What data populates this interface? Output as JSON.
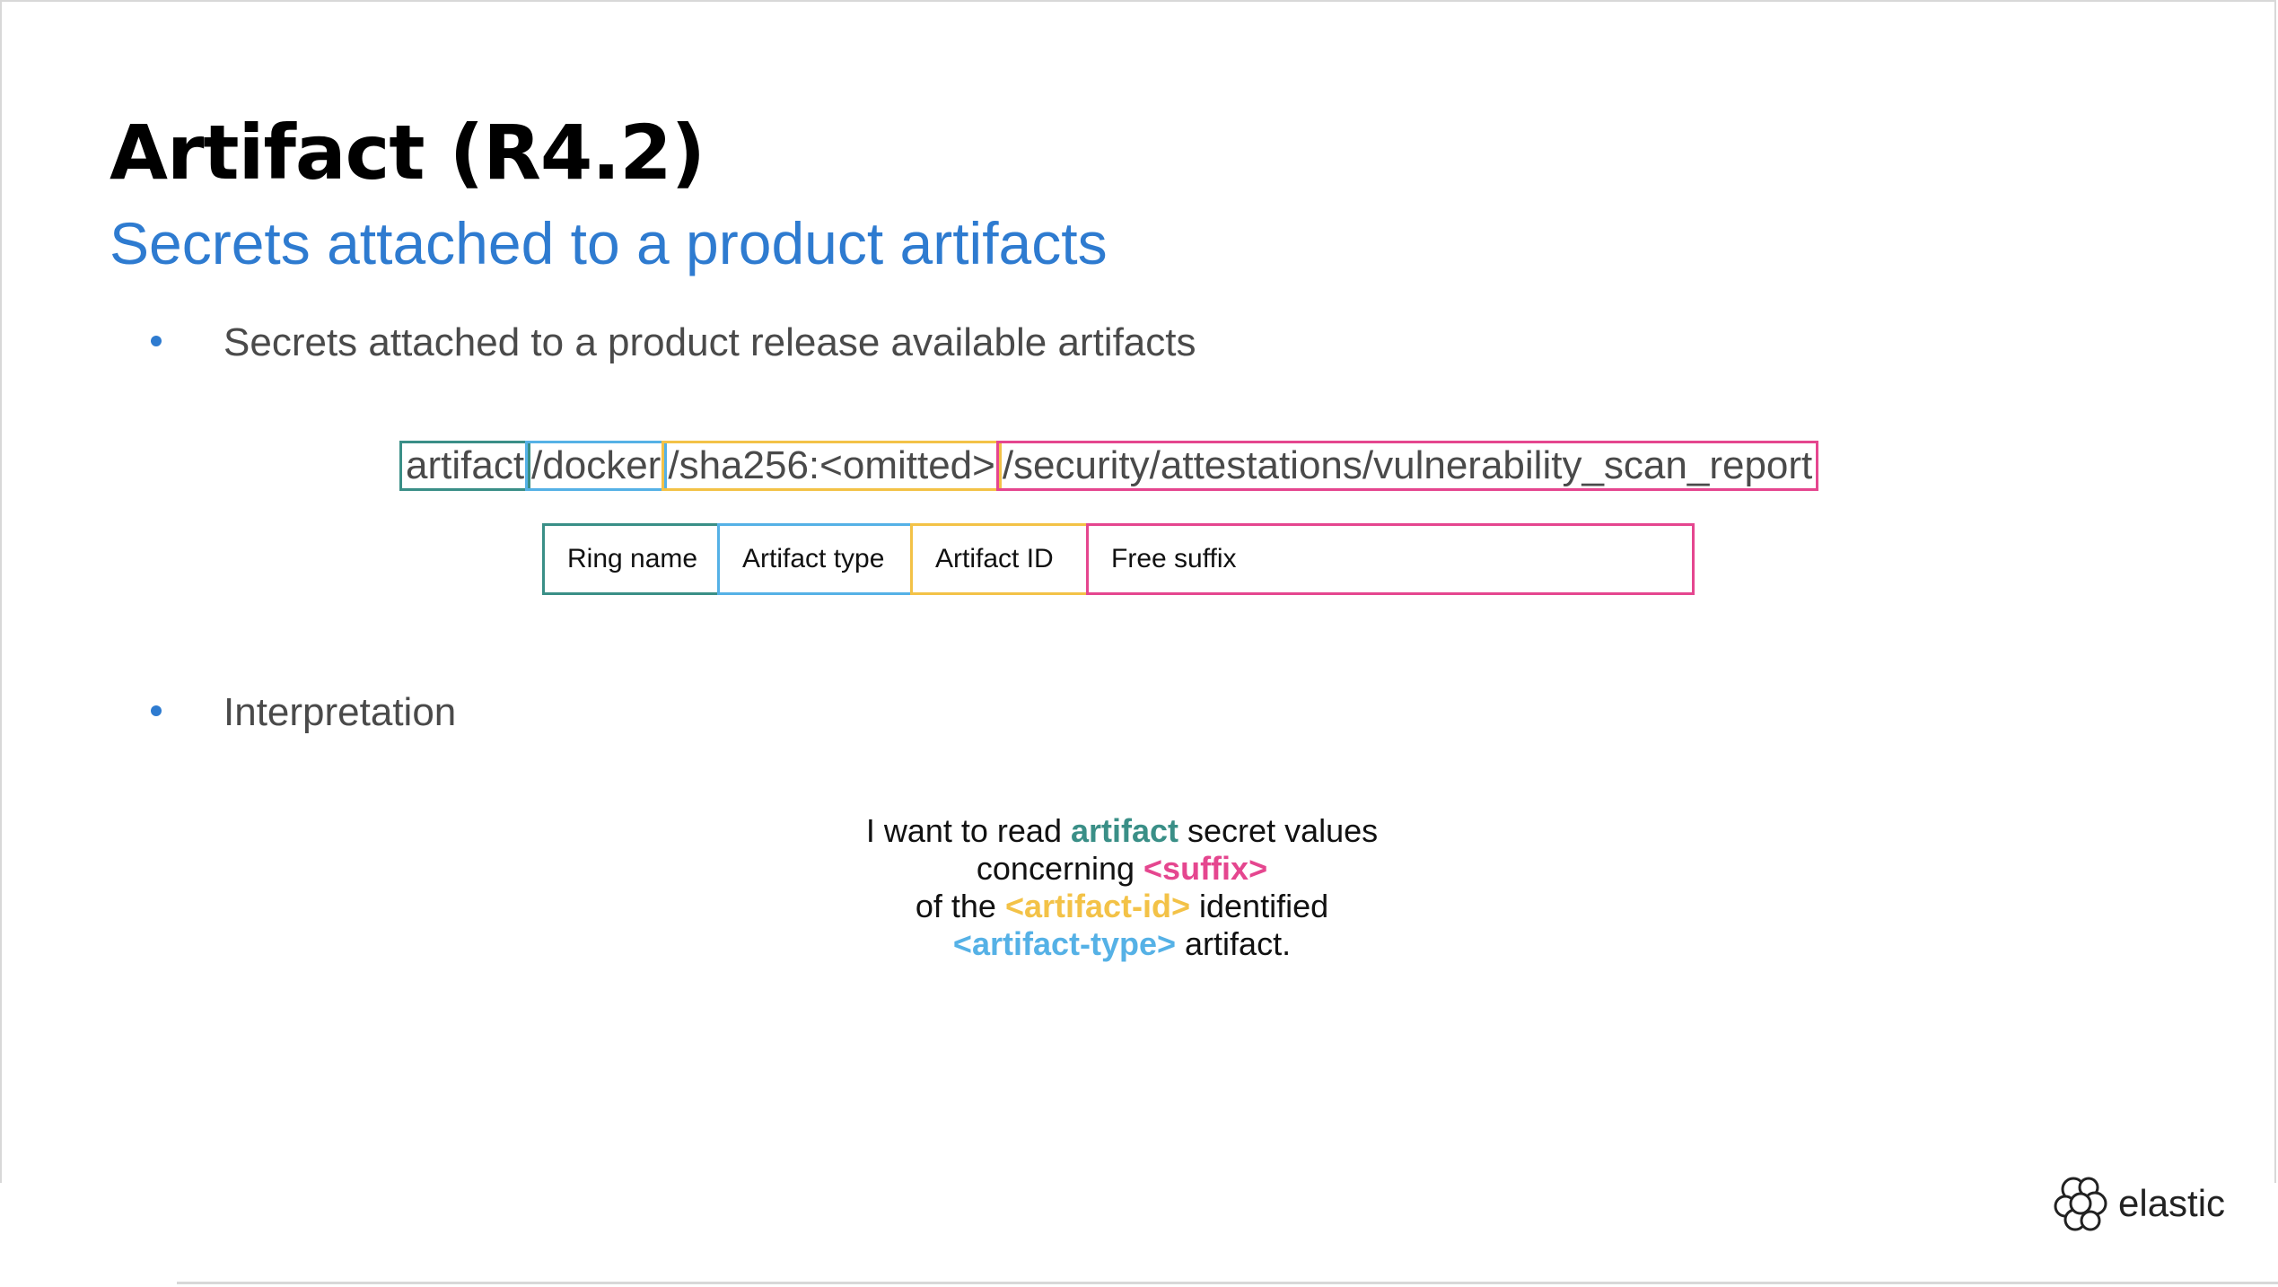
{
  "slide": {
    "title": "Artifact (R4.2)",
    "subtitle": "Secrets attached to a product artifacts"
  },
  "bullets": [
    {
      "text": "Secrets attached to a product release available artifacts"
    },
    {
      "text": "Interpretation"
    }
  ],
  "path": {
    "segments": [
      {
        "text": "artifact",
        "color": "#3a8f87"
      },
      {
        "text": "/docker",
        "color": "#55b1e6"
      },
      {
        "text": "/sha256:<omitted>",
        "color": "#f3c247"
      },
      {
        "text": "/security/attestations/vulnerability_scan_report",
        "color": "#e5468f"
      }
    ]
  },
  "legend": [
    {
      "label": "Ring name",
      "color": "#3a8f87"
    },
    {
      "label": "Artifact type",
      "color": "#55b1e6"
    },
    {
      "label": "Artifact ID",
      "color": "#f3c247"
    },
    {
      "label": "Free suffix",
      "color": "#e5468f"
    }
  ],
  "interpretation": {
    "l1_pre": "I want to read ",
    "l1_hl": "artifact",
    "l1_post": " secret values",
    "l2_pre": "concerning ",
    "l2_hl": "<suffix>",
    "l3_pre": "of the ",
    "l3_hl": "<artifact-id>",
    "l3_post": " identified",
    "l4_hl": "<artifact-type>",
    "l4_post": " artifact."
  },
  "logo": {
    "text": "elastic",
    "icon": "elastic-logo-icon"
  },
  "colors": {
    "accent_blue": "#2e7bd0",
    "ring": "#3a8f87",
    "type": "#55b1e6",
    "id": "#f3c247",
    "suffix": "#e5468f"
  }
}
